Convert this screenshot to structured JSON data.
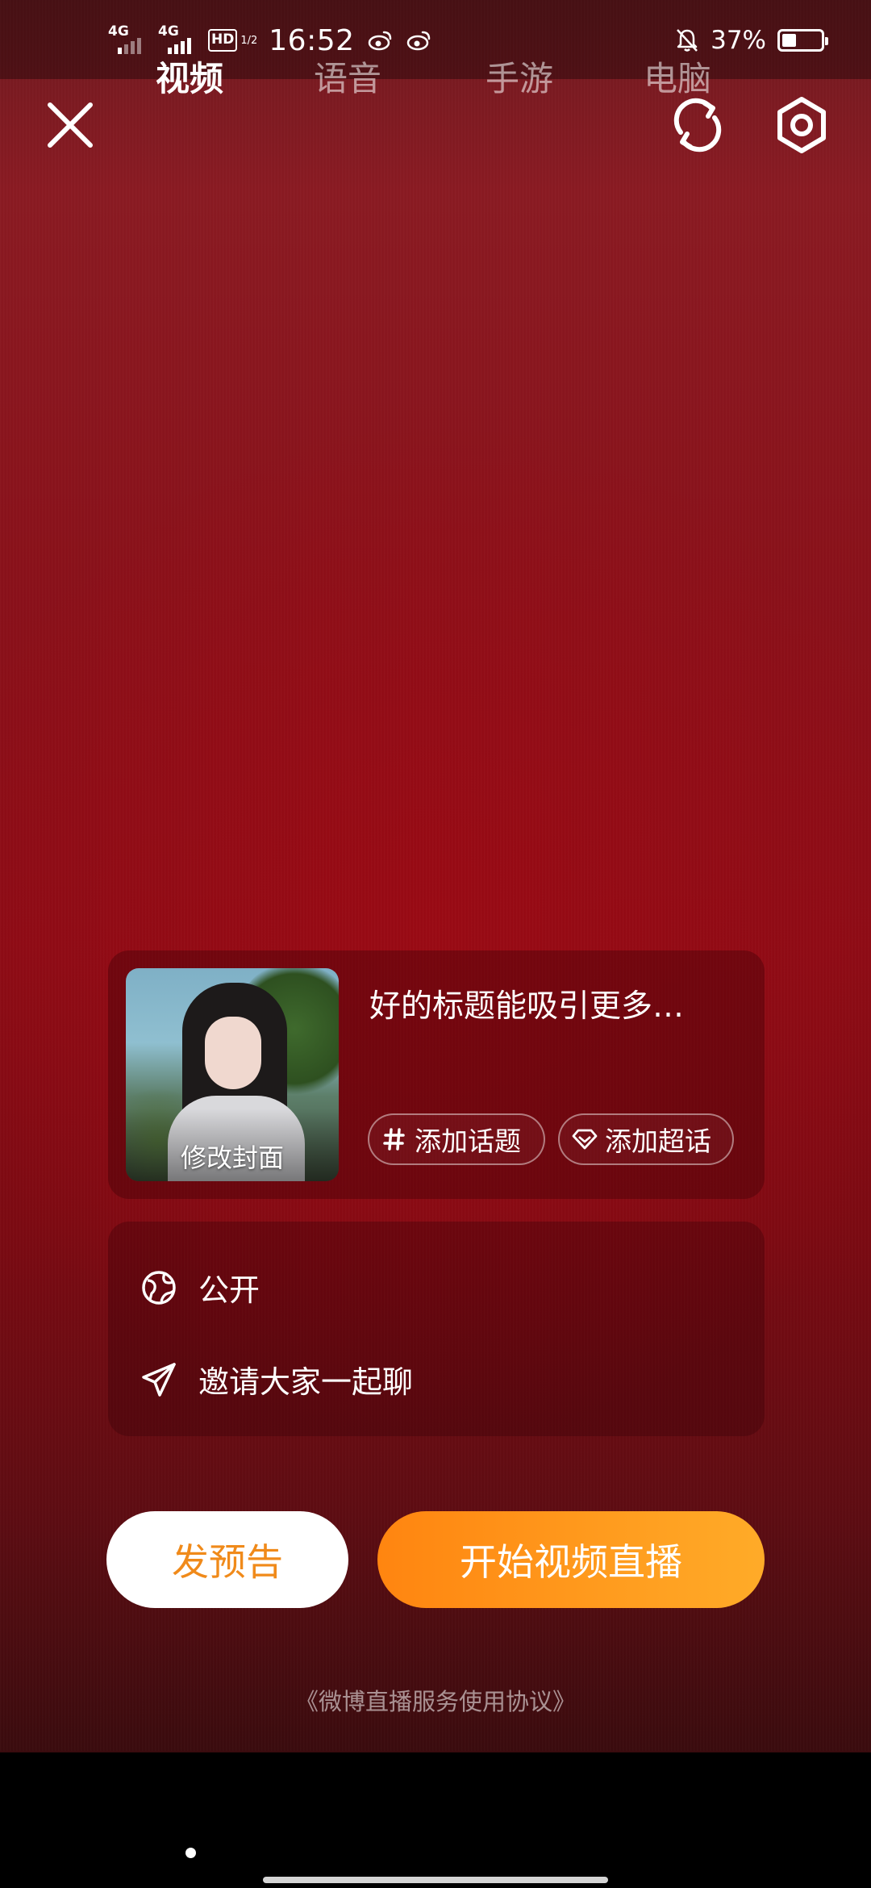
{
  "status_bar": {
    "signal1_label": "4G",
    "signal2_label": "4G",
    "hd_label": "HD",
    "hd_sub": "1/2",
    "time": "16:52",
    "battery_percent": "37%",
    "battery_level": 0.37,
    "icons": [
      "signal-icon",
      "signal-icon",
      "hd-voice-icon",
      "weibo-icon",
      "weibo-icon",
      "mute-bell-icon",
      "battery-icon"
    ]
  },
  "top_bar": {
    "icons": [
      "close-icon",
      "flip-camera-icon",
      "settings-icon"
    ]
  },
  "info_card": {
    "cover_label": "修改封面",
    "title_placeholder": "好的标题能吸引更多…",
    "topic_chip": "添加话题",
    "super_chip": "添加超话"
  },
  "options": {
    "visibility": "公开",
    "invite": "邀请大家一起聊"
  },
  "actions": {
    "preview": "发预告",
    "start": "开始视频直播"
  },
  "agreement": "《微博直播服务使用协议》",
  "tabs": [
    {
      "label": "视频",
      "active": true
    },
    {
      "label": "语音",
      "active": false
    },
    {
      "label": "手游",
      "active": false
    },
    {
      "label": "电脑",
      "active": false
    }
  ],
  "colors": {
    "accent_orange": "#ff8510",
    "accent_orange_end": "#ffab28",
    "background_red": "#8d0b15"
  }
}
